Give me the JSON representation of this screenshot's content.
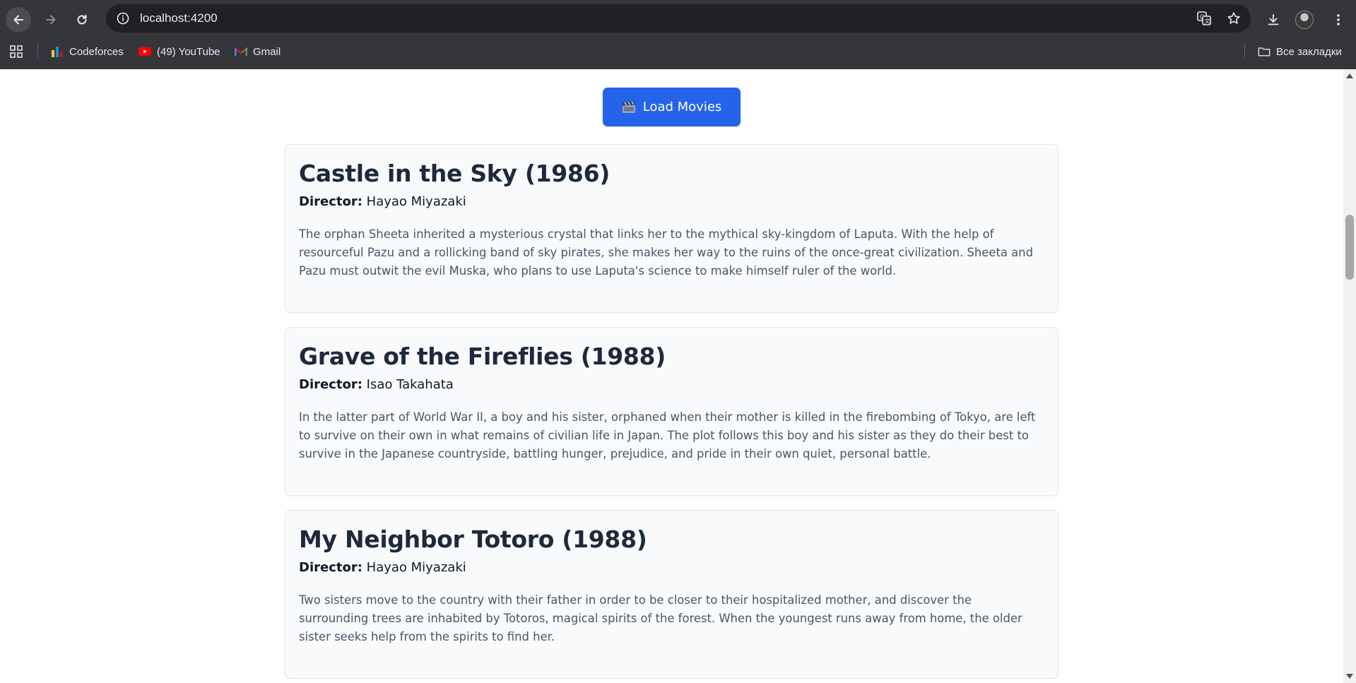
{
  "browser": {
    "url": "localhost:4200",
    "bookmarks": [
      {
        "label": "Codeforces",
        "icon": "codeforces-icon"
      },
      {
        "label": "(49) YouTube",
        "icon": "youtube-icon"
      },
      {
        "label": "Gmail",
        "icon": "gmail-icon"
      }
    ],
    "all_bookmarks_label": "Все закладки"
  },
  "page": {
    "load_button": {
      "label": "Load Movies",
      "icon": "clapperboard-icon"
    },
    "director_label": "Director:",
    "movies": [
      {
        "title": "Castle in the Sky (1986)",
        "director": "Hayao Miyazaki",
        "description": "The orphan Sheeta inherited a mysterious crystal that links her to the mythical sky-kingdom of Laputa. With the help of resourceful Pazu and a rollicking band of sky pirates, she makes her way to the ruins of the once-great civilization. Sheeta and Pazu must outwit the evil Muska, who plans to use Laputa's science to make himself ruler of the world."
      },
      {
        "title": "Grave of the Fireflies (1988)",
        "director": "Isao Takahata",
        "description": "In the latter part of World War II, a boy and his sister, orphaned when their mother is killed in the firebombing of Tokyo, are left to survive on their own in what remains of civilian life in Japan. The plot follows this boy and his sister as they do their best to survive in the Japanese countryside, battling hunger, prejudice, and pride in their own quiet, personal battle."
      },
      {
        "title": "My Neighbor Totoro (1988)",
        "director": "Hayao Miyazaki",
        "description": "Two sisters move to the country with their father in order to be closer to their hospitalized mother, and discover the surrounding trees are inhabited by Totoros, magical spirits of the forest. When the youngest runs away from home, the older sister seeks help from the spirits to find her."
      }
    ]
  },
  "colors": {
    "accent": "#2563eb",
    "chrome": "#35363a",
    "card_bg": "#f8fafc"
  }
}
